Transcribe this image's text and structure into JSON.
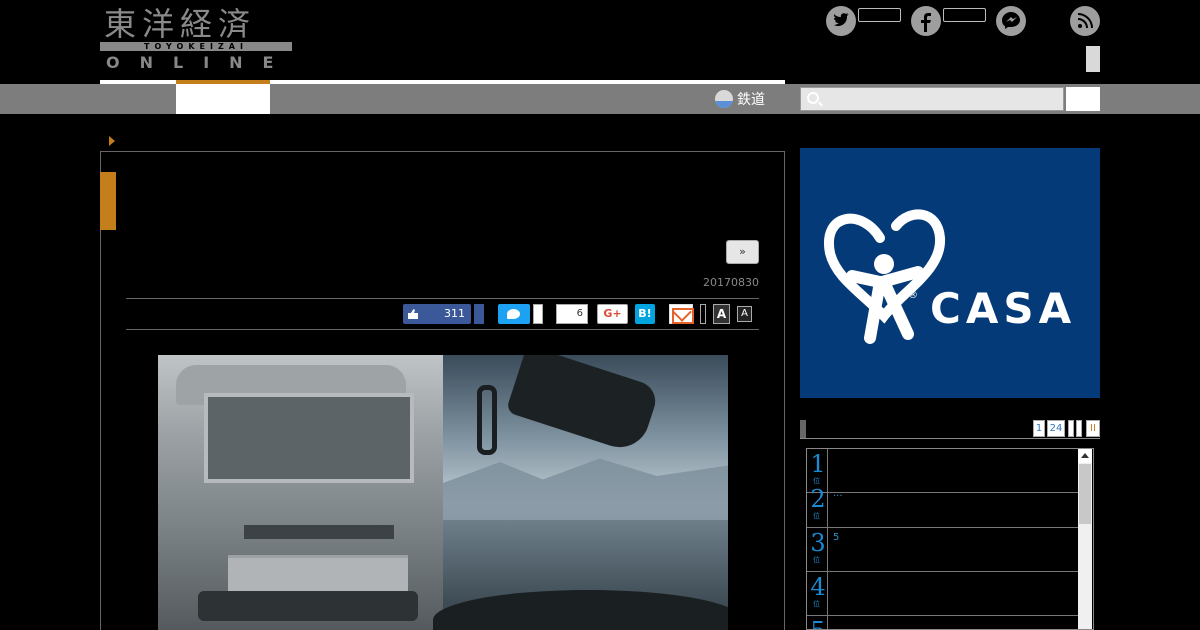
{
  "header": {
    "logo_kanji": "東洋経済",
    "logo_roman": "TOYOKEIZAI",
    "logo_online": "ONLINE"
  },
  "nav": {
    "category_link": "鉄道"
  },
  "article": {
    "next_label": "»",
    "date": "20170830"
  },
  "share": {
    "fb_like_count": "311",
    "hatena_count": "6",
    "gplus_label": "G+",
    "hatebu_label": "B!",
    "font_large_label": "A",
    "font_small_label": "A"
  },
  "ad": {
    "brand": "CASA",
    "reg_mark": "®"
  },
  "ranking": {
    "tabs": [
      "1",
      "24",
      "",
      "",
      "II"
    ],
    "items": [
      {
        "num": "1",
        "text": ""
      },
      {
        "num": "2",
        "text": "..."
      },
      {
        "num": "3",
        "text": "5"
      },
      {
        "num": "4",
        "text": ""
      },
      {
        "num": "5",
        "text": ""
      }
    ]
  },
  "colors": {
    "accent": "#c47e1c",
    "ad_bg": "#053a78",
    "rank_blue": "#1a8ad4",
    "nav_gray": "#7d7d7d"
  },
  "icons": [
    "twitter-icon",
    "facebook-icon",
    "messenger-icon",
    "rss-icon",
    "search-icon",
    "rail-icon",
    "mail-icon"
  ]
}
